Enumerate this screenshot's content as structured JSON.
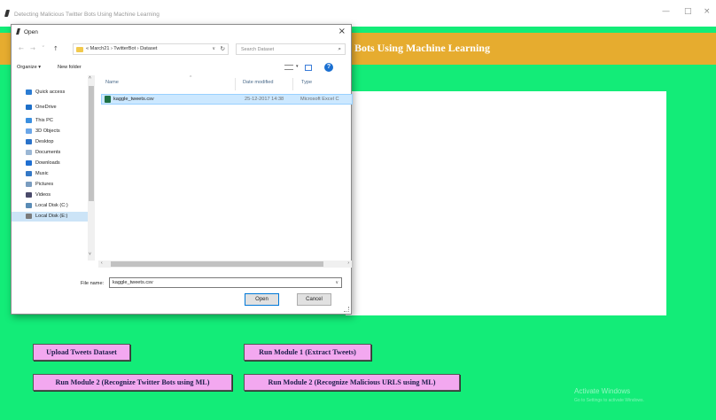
{
  "window": {
    "title": "Detecting Malicious Twitter Bots Using Machine Learning",
    "minimize": "—",
    "maximize": "□",
    "close": "×"
  },
  "header": {
    "title": "Detecting Malicious Twitter Bots Using Machine Learning"
  },
  "buttons": {
    "upload": "Upload Tweets Dataset",
    "module1": "Run Module 1 (Extract Tweets)",
    "module2_bots": "Run Module 2 (Recognize Twitter Bots using ML)",
    "module2_urls": "Run Module 2 (Recognize Malicious URLS using ML)"
  },
  "watermark": {
    "title": "Activate Windows",
    "subtitle": "Go to Settings to activate Windows."
  },
  "dialog": {
    "title": "Open",
    "close": "×",
    "address": {
      "path": "«  March21  ›  TwitterBot  ›  Dataset",
      "dropdown": "∨",
      "refresh": "↻"
    },
    "search": {
      "placeholder": "Search Dataset",
      "icon": "⌕"
    },
    "nav": {
      "back": "←",
      "forward": "→",
      "recent": "˅",
      "up": "↑"
    },
    "toolbar": {
      "organize": "Organize ▾",
      "new_folder": "New folder",
      "view_dropdown": "▾",
      "help": "?"
    },
    "sidebar": {
      "items": [
        {
          "label": "Quick access",
          "icon": "star-icon",
          "color": "#2b7cd3"
        },
        {
          "label": "OneDrive",
          "icon": "cloud-icon",
          "color": "#1e6fc8"
        },
        {
          "label": "This PC",
          "icon": "computer-icon",
          "color": "#3b8fe0"
        },
        {
          "label": "3D Objects",
          "icon": "cube-icon",
          "color": "#6aa6e8"
        },
        {
          "label": "Desktop",
          "icon": "desktop-icon",
          "color": "#2a72c9"
        },
        {
          "label": "Documents",
          "icon": "documents-icon",
          "color": "#9bb7d4"
        },
        {
          "label": "Downloads",
          "icon": "download-icon",
          "color": "#1f6fd1"
        },
        {
          "label": "Music",
          "icon": "music-icon",
          "color": "#3478c6"
        },
        {
          "label": "Pictures",
          "icon": "pictures-icon",
          "color": "#7a9cbf"
        },
        {
          "label": "Videos",
          "icon": "videos-icon",
          "color": "#4a4a6a"
        },
        {
          "label": "Local Disk (C:)",
          "icon": "drive-icon",
          "color": "#5a8bb5"
        },
        {
          "label": "Local Disk (E:)",
          "icon": "drive-icon",
          "color": "#7a7a7a"
        }
      ]
    },
    "columns": {
      "name": "Name",
      "date": "Date modified",
      "type": "Type",
      "sort_caret": "^"
    },
    "files": [
      {
        "name": "kaggle_tweets.csv",
        "date": "25-12-2017 14:38",
        "type": "Microsoft Excel C",
        "icon": "excel-csv-icon"
      }
    ],
    "filename_label": "File name:",
    "filename_value": "kaggle_tweets.csv",
    "filename_dropdown": "∨",
    "open_button": "Open",
    "cancel_button": "Cancel",
    "scroll": {
      "up": "˄",
      "down": "˅",
      "left": "‹",
      "right": "›"
    }
  },
  "colors": {
    "background": "#13ec78",
    "header_bar": "#e6ac2f",
    "button_bg": "#f3a8f0",
    "button_text": "#1d1d4a"
  }
}
